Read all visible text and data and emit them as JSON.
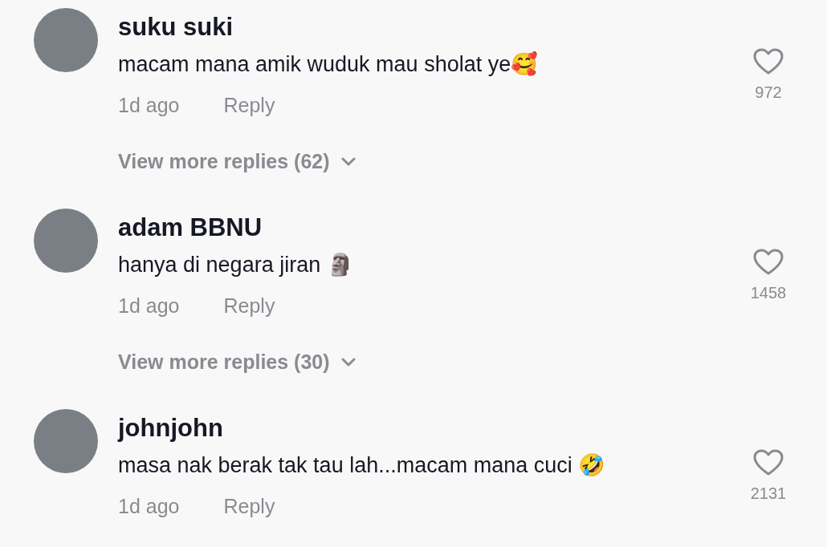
{
  "comments": [
    {
      "username": "suku suki",
      "text": "macam mana amik wuduk mau sholat ye🥰",
      "time": "1d ago",
      "reply": "Reply",
      "likes": "972",
      "more_replies": "View more replies (62)"
    },
    {
      "username": "adam BBNU",
      "text": "hanya di negara jiran 🗿",
      "time": "1d ago",
      "reply": "Reply",
      "likes": "1458",
      "more_replies": "View more replies (30)"
    },
    {
      "username": "johnjohn",
      "text": "masa nak berak tak tau lah...macam mana cuci 🤣",
      "time": "1d ago",
      "reply": "Reply",
      "likes": "2131"
    }
  ]
}
